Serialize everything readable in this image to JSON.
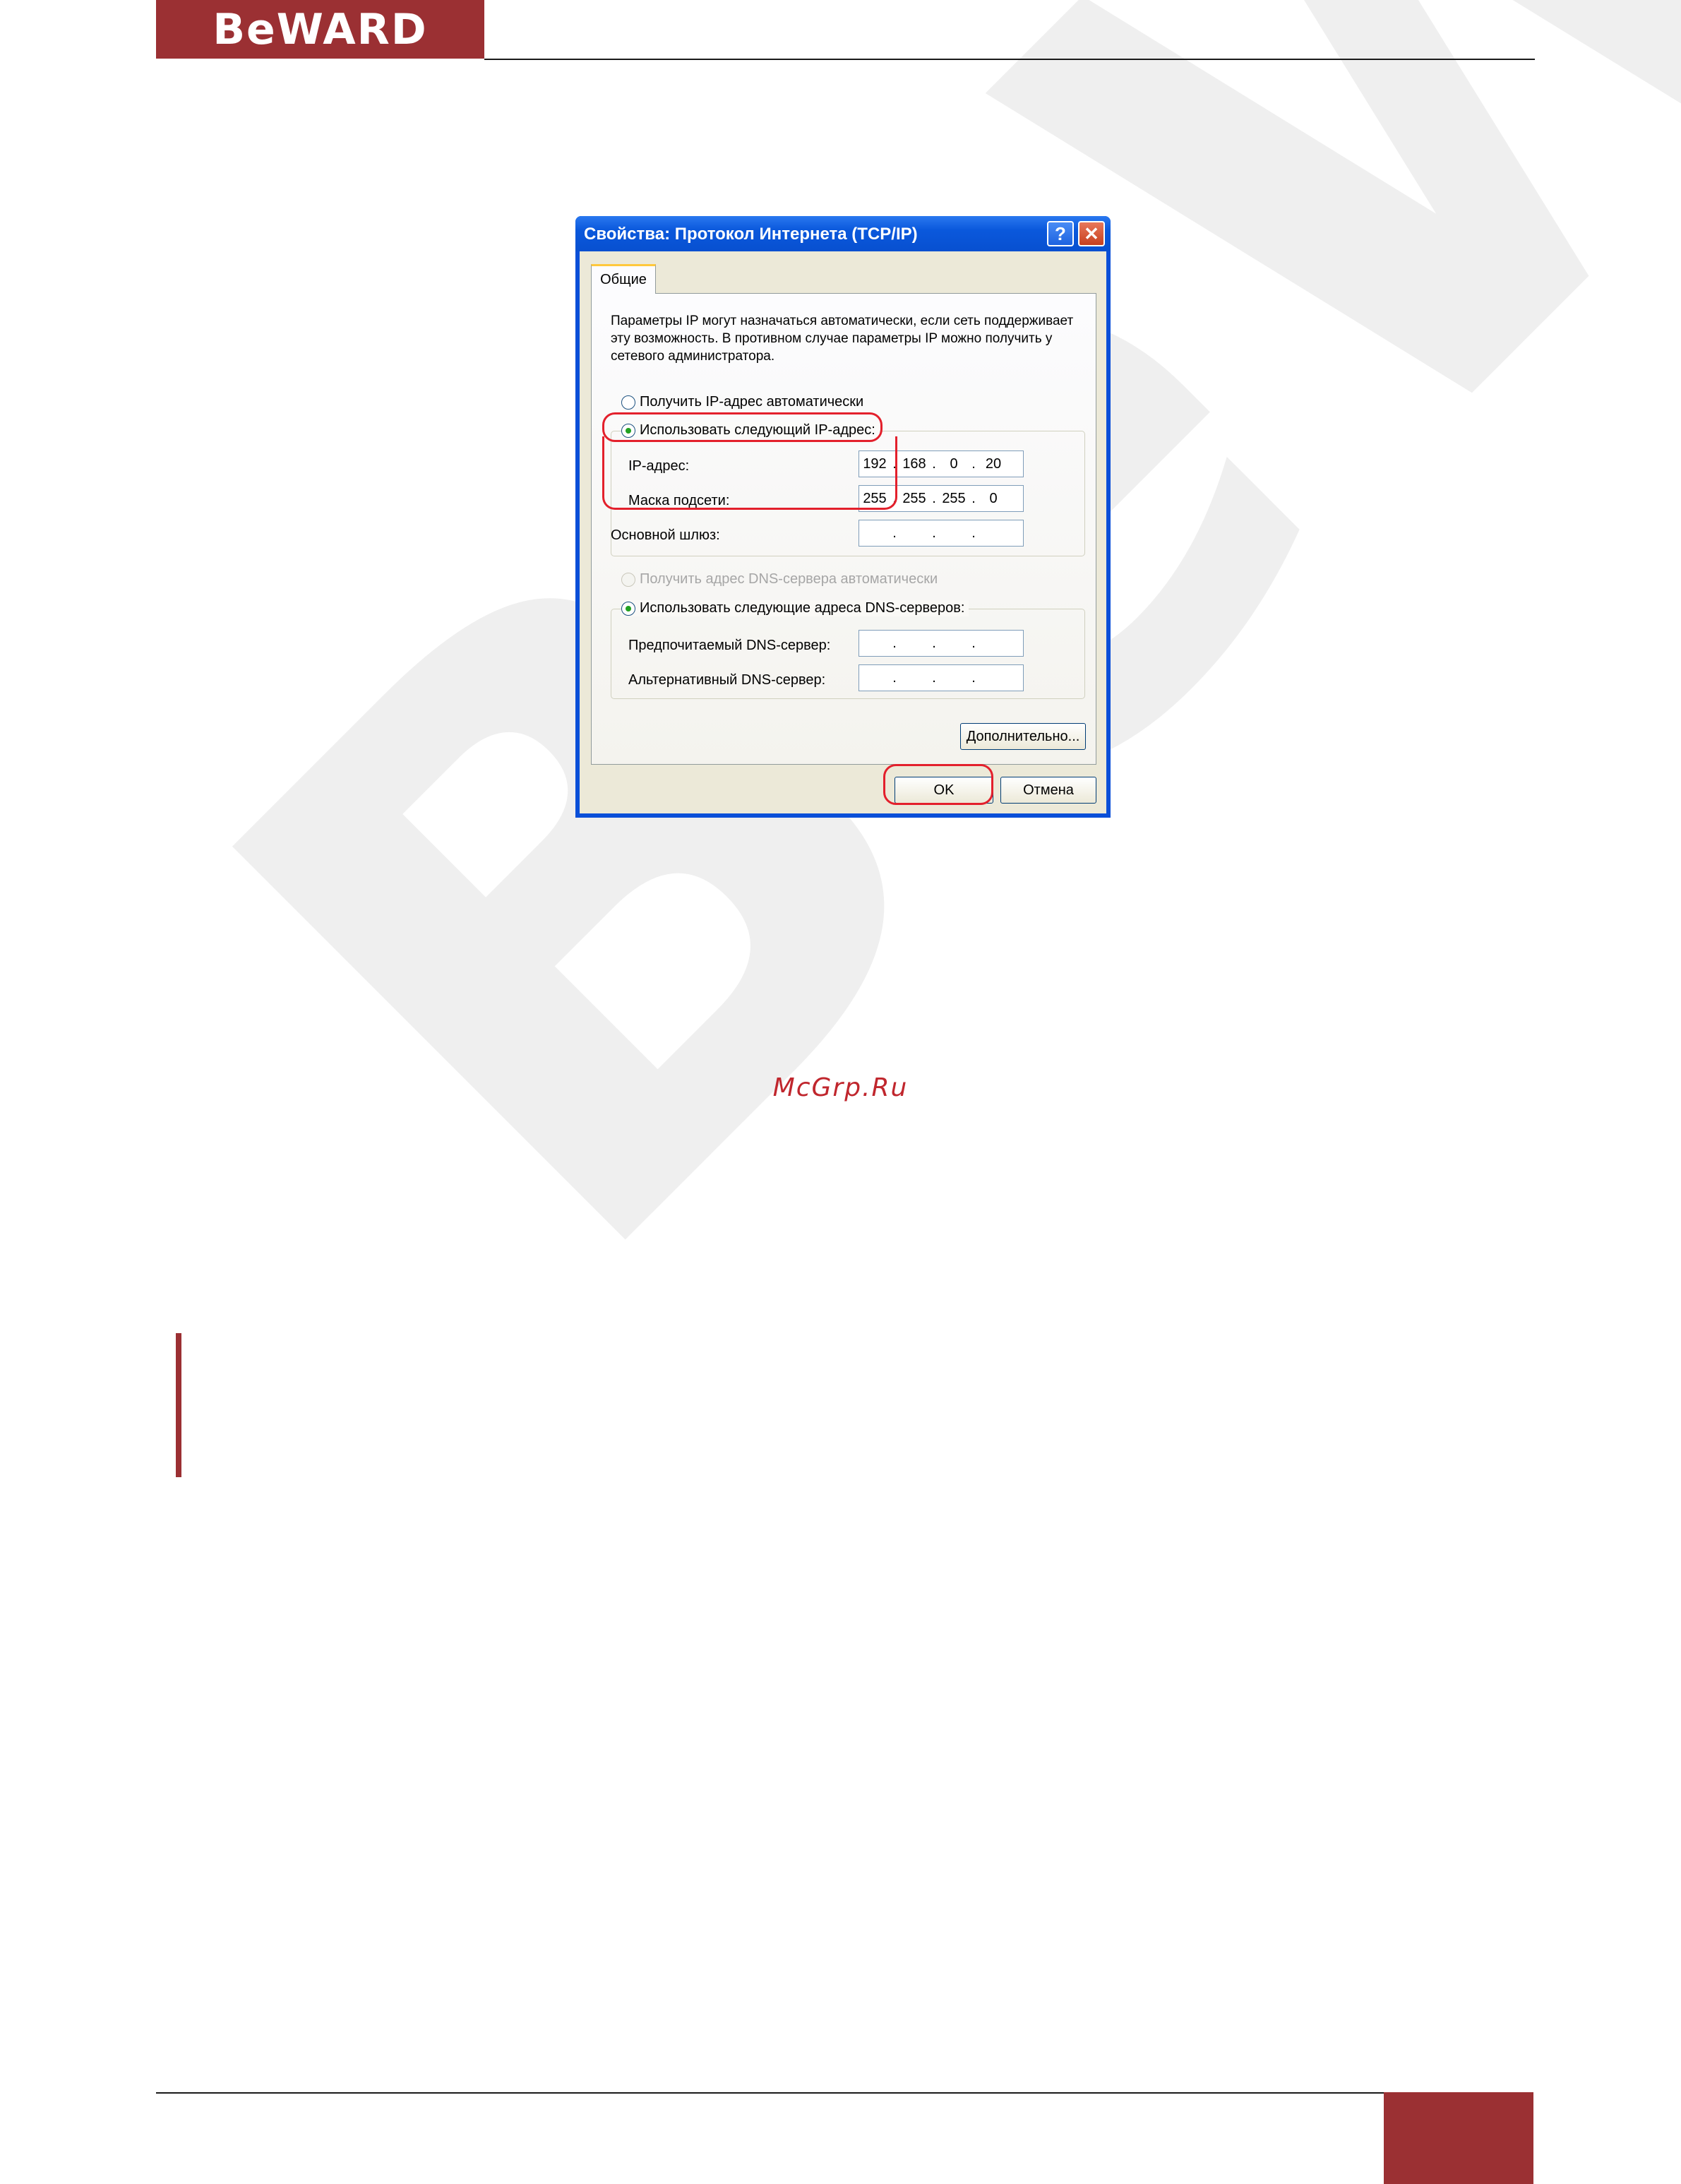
{
  "header": {
    "brand": "BeWARD",
    "accent_color": "#9b3033"
  },
  "watermark": {
    "text": "BeWARD"
  },
  "dialog": {
    "title": "Свойства: Протокол Интернета (TCP/IP)",
    "help_icon": "?",
    "close_icon": "✕",
    "tab_label": "Общие",
    "description": "Параметры IP могут назначаться автоматически, если сеть поддерживает эту возможность. В противном случае параметры IP можно получить у сетевого администратора.",
    "radio_auto_ip": "Получить IP-адрес автоматически",
    "radio_manual_ip": "Использовать следующий IP-адрес:",
    "ip_label": "IP-адрес:",
    "ip_value": [
      "192",
      "168",
      "0",
      "20"
    ],
    "mask_label": "Маска подсети:",
    "mask_value": [
      "255",
      "255",
      "255",
      "0"
    ],
    "gateway_label": "Основной шлюз:",
    "gateway_value": [
      "",
      "",
      "",
      ""
    ],
    "radio_auto_dns": "Получить адрес DNS-сервера автоматически",
    "radio_manual_dns": "Использовать следующие адреса DNS-серверов:",
    "preferred_dns_label": "Предпочитаемый DNS-сервер:",
    "alternate_dns_label": "Альтернативный DNS-сервер:",
    "advanced_button": "Дополнительно...",
    "ok_button": "OK",
    "cancel_button": "Отмена",
    "highlight_color": "#e3202c"
  },
  "source_link": "McGrp.Ru"
}
